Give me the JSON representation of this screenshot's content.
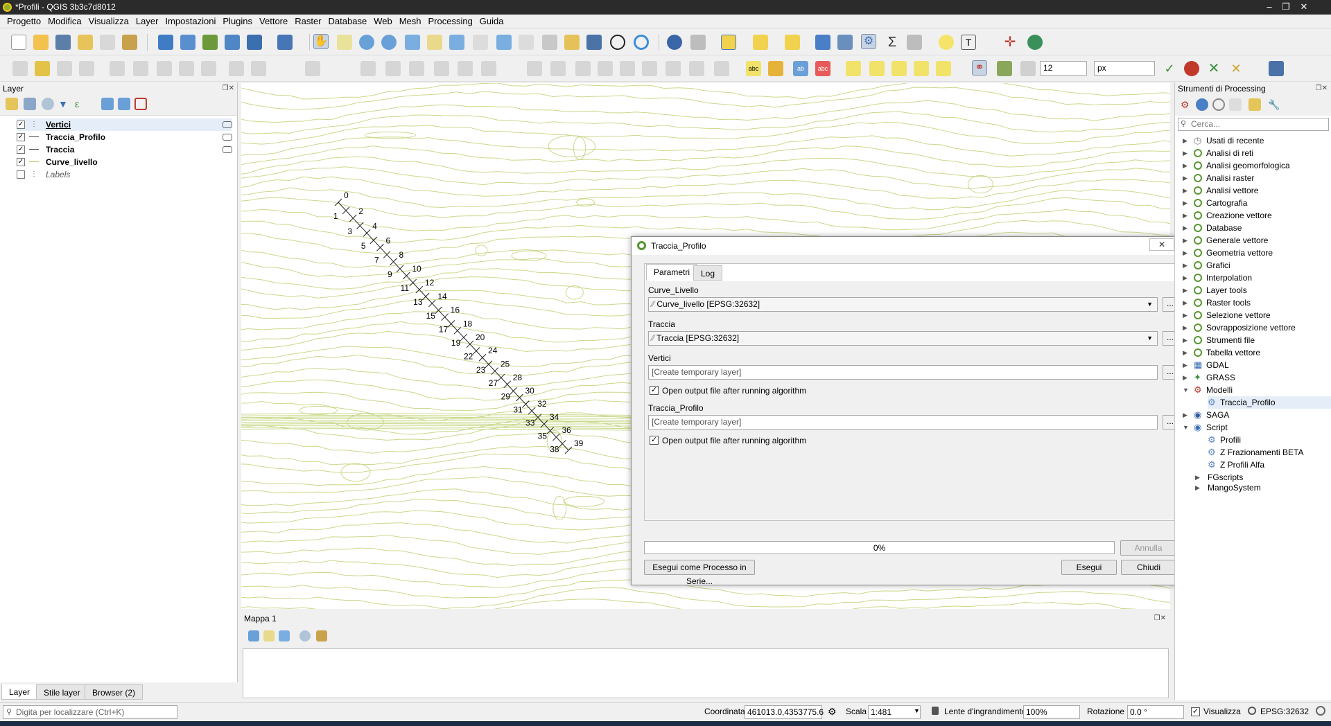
{
  "window": {
    "title": "*Profili - QGIS 3b3c7d8012"
  },
  "menu": [
    "Progetto",
    "Modifica",
    "Visualizza",
    "Layer",
    "Impostazioni",
    "Plugins",
    "Vettore",
    "Raster",
    "Database",
    "Web",
    "Mesh",
    "Processing",
    "Guida"
  ],
  "toolbar2": {
    "snap_tolerance": "12",
    "snap_unit": "px"
  },
  "layers_panel": {
    "title": "Layer",
    "items": [
      {
        "name": "Vertici",
        "checked": true,
        "style": "bold-underline"
      },
      {
        "name": "Traccia_Profilo",
        "checked": true,
        "style": "bold"
      },
      {
        "name": "Traccia",
        "checked": true,
        "style": "bold"
      },
      {
        "name": "Curve_livello",
        "checked": true,
        "style": "bold"
      },
      {
        "name": "Labels",
        "checked": false,
        "style": "italic"
      }
    ]
  },
  "profile_labels": [
    "0",
    "1",
    "2",
    "3",
    "4",
    "5",
    "6",
    "7",
    "8",
    "9",
    "10",
    "11",
    "12",
    "13",
    "14",
    "15",
    "16",
    "17",
    "18",
    "19",
    "20",
    "22",
    "24",
    "23",
    "25",
    "27",
    "28",
    "29",
    "30",
    "31",
    "32",
    "33",
    "34",
    "35",
    "36",
    "38",
    "39"
  ],
  "dialog": {
    "title": "Traccia_Profilo",
    "tabs": [
      "Parametri",
      "Log"
    ],
    "curve_label": "Curve_Livello",
    "curve_value": "Curve_livello [EPSG:32632]",
    "traccia_label": "Traccia",
    "traccia_value": "Traccia [EPSG:32632]",
    "vertici_label": "Vertici",
    "vertici_placeholder": "[Create temporary layer]",
    "open_output_label": "Open output file after running algorithm",
    "traccia_profilo_label": "Traccia_Profilo",
    "traccia_profilo_placeholder": "[Create temporary layer]",
    "progress": "0%",
    "progress_value": 0,
    "cancel": "Annulla",
    "batch": "Esegui come Processo in Serie...",
    "run": "Esegui",
    "close": "Chiudi",
    "browse": "..."
  },
  "map2": {
    "title": "Mappa 1"
  },
  "processing_panel": {
    "title": "Strumenti di Processing",
    "search_placeholder": "Cerca...",
    "items": [
      {
        "label": "Usati di recente",
        "icon": "clock"
      },
      {
        "label": "Analisi di reti",
        "icon": "qgis"
      },
      {
        "label": "Analisi geomorfologica",
        "icon": "qgis"
      },
      {
        "label": "Analisi raster",
        "icon": "qgis"
      },
      {
        "label": "Analisi vettore",
        "icon": "qgis"
      },
      {
        "label": "Cartografia",
        "icon": "qgis"
      },
      {
        "label": "Creazione vettore",
        "icon": "qgis"
      },
      {
        "label": "Database",
        "icon": "qgis"
      },
      {
        "label": "Generale vettore",
        "icon": "qgis"
      },
      {
        "label": "Geometria vettore",
        "icon": "qgis"
      },
      {
        "label": "Grafici",
        "icon": "qgis"
      },
      {
        "label": "Interpolation",
        "icon": "qgis"
      },
      {
        "label": "Layer tools",
        "icon": "qgis"
      },
      {
        "label": "Raster tools",
        "icon": "qgis"
      },
      {
        "label": "Selezione vettore",
        "icon": "qgis"
      },
      {
        "label": "Sovrapposizione vettore",
        "icon": "qgis"
      },
      {
        "label": "Strumenti file",
        "icon": "qgis"
      },
      {
        "label": "Tabella vettore",
        "icon": "qgis"
      },
      {
        "label": "GDAL",
        "icon": "gdal"
      },
      {
        "label": "GRASS",
        "icon": "grass"
      },
      {
        "label": "Modelli",
        "icon": "model"
      },
      {
        "label": "Traccia_Profilo",
        "icon": "gear",
        "child": true,
        "selected": true
      },
      {
        "label": "SAGA",
        "icon": "saga"
      },
      {
        "label": "Script",
        "icon": "python"
      },
      {
        "label": "Profili",
        "icon": "gear",
        "child": true
      },
      {
        "label": "Z Frazionamenti BETA",
        "icon": "gear",
        "child": true
      },
      {
        "label": "Z Profili Alfa",
        "icon": "gear",
        "child": true
      },
      {
        "label": "FGscripts",
        "icon": "none"
      },
      {
        "label": "MangoSystem",
        "icon": "none"
      }
    ]
  },
  "bottom_tabs": [
    "Layer",
    "Stile layer",
    "Browser (2)"
  ],
  "status": {
    "locator_placeholder": "Digita per localizzare (Ctrl+K)",
    "coord_label": "Coordinata",
    "coord_value": "461013.0,4353775.6",
    "scale_label": "Scala",
    "scale_value": "1:481",
    "magnifier_label": "Lente d'ingrandimento",
    "magnifier_value": "100%",
    "rotation_label": "Rotazione",
    "rotation_value": "0.0 °",
    "render_label": "Visualizza",
    "crs": "EPSG:32632"
  },
  "colors": {
    "contour": "#c8d98a",
    "accent": "#589632"
  }
}
